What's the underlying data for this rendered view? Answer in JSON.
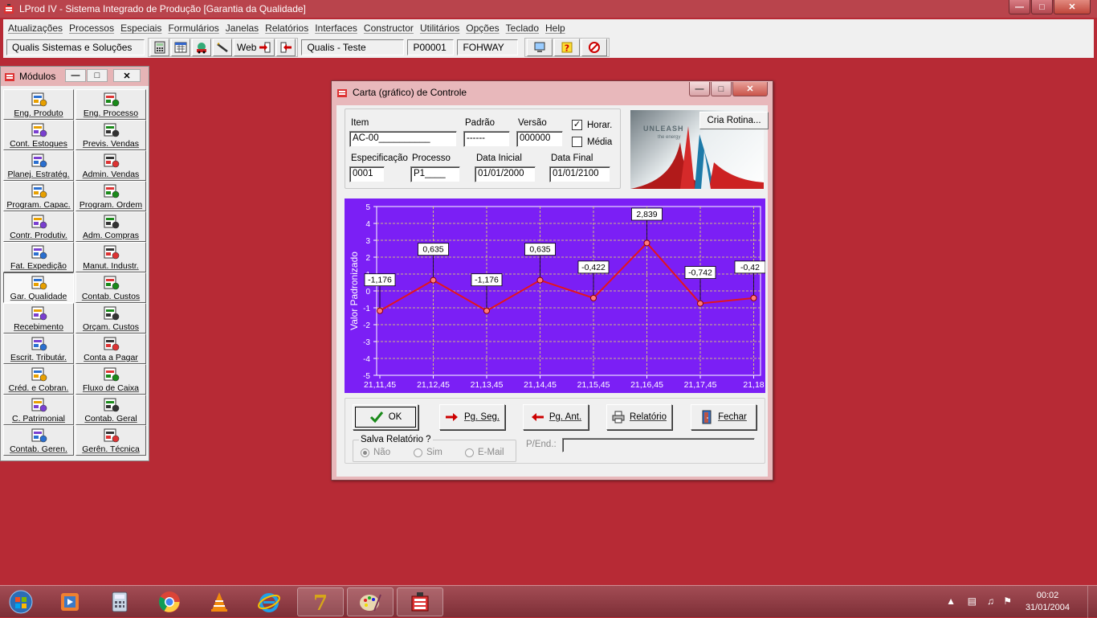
{
  "app": {
    "title": "LProd IV - Sistema Integrado de Produção [Garantia da Qualidade]"
  },
  "menu": [
    "Atualizações",
    "Processos",
    "Especiais",
    "Formulários",
    "Janelas",
    "Relatórios",
    "Interfaces",
    "Constructor",
    "Utilitários",
    "Opções",
    "Teclado",
    "Help"
  ],
  "toolbar": {
    "company": "Qualis Sistemas e Soluções",
    "web_label": "Web",
    "environment": "Qualis - Teste",
    "code": "P00001",
    "user": "FOHWAY"
  },
  "modules": {
    "title": "Módulos",
    "items": [
      {
        "label": "Eng. Produto",
        "icon": "handshake-icon"
      },
      {
        "label": "Eng. Processo",
        "icon": "gear-person-icon"
      },
      {
        "label": "Cont. Estoques",
        "icon": "boxes-icon"
      },
      {
        "label": "Previs. Vendas",
        "icon": "pie-chart-icon"
      },
      {
        "label": "Planej. Estratég.",
        "icon": "bar-chart-icon"
      },
      {
        "label": "Admin. Vendas",
        "icon": "sales-icon"
      },
      {
        "label": "Program. Capac.",
        "icon": "calendar-grid-icon"
      },
      {
        "label": "Program. Ordem",
        "icon": "calendar-icon"
      },
      {
        "label": "Contr. Produtiv.",
        "icon": "line-chart-icon"
      },
      {
        "label": "Adm. Compras",
        "icon": "documents-icon"
      },
      {
        "label": "Fat. Expedição",
        "icon": "arrow-document-icon"
      },
      {
        "label": "Manut. Industr.",
        "icon": "tools-icon"
      },
      {
        "label": "Gar. Qualidade",
        "icon": "quality-chart-icon"
      },
      {
        "label": "Contab. Custos",
        "icon": "calculator-icon"
      },
      {
        "label": "Recebimento",
        "icon": "arrow-in-document-icon"
      },
      {
        "label": "Orçam. Custos",
        "icon": "ledger-icon"
      },
      {
        "label": "Escrit. Tributár.",
        "icon": "books-icon"
      },
      {
        "label": "Conta a Pagar",
        "icon": "payment-icon"
      },
      {
        "label": "Créd. e Cobran.",
        "icon": "money-hand-icon"
      },
      {
        "label": "Fluxo de Caixa",
        "icon": "cash-flow-icon"
      },
      {
        "label": "C. Patrimonial",
        "icon": "building-icon"
      },
      {
        "label": "Contab. Geral",
        "icon": "open-book-icon"
      },
      {
        "label": "Contab. Geren.",
        "icon": "report-icon"
      },
      {
        "label": "Gerên. Técnica",
        "icon": "computer-icon"
      }
    ],
    "active_index": 12
  },
  "dialog": {
    "title": "Carta (gráfico) de Controle",
    "item_label": "Item",
    "item_value": "AC-00__________",
    "padrao_label": "Padrão",
    "padrao_value": "------",
    "versao_label": "Versão",
    "versao_value": "000000",
    "horar_label": "Horar.",
    "horar_checked": true,
    "media_label": "Média",
    "media_checked": false,
    "espec_label": "Especificação",
    "espec_value": "0001",
    "processo_label": "Processo",
    "processo_value": "P1____",
    "data_ini_label": "Data Inicial",
    "data_ini_value": "01/01/2000",
    "data_fim_label": "Data Final",
    "data_fim_value": "01/01/2100",
    "cria_rotina_label": "Cria Rotina...",
    "logo_text": "UNLEASH",
    "logo_sub": "the energy",
    "buttons": {
      "ok": "OK",
      "next": "Pg. Seg.",
      "prev": "Pg. Ant.",
      "report": "Relatório",
      "close": "Fechar"
    },
    "save_report_label": "Salva Relatório ?",
    "radio": {
      "no": "Não",
      "yes": "Sim",
      "email": "E-Mail",
      "selected": "no"
    },
    "pend_label": "P/End.:"
  },
  "chart_data": {
    "type": "line",
    "ylabel": "Valor Padronizado",
    "ylim": [
      -5,
      5
    ],
    "yticks": [
      5,
      4,
      3,
      2,
      1,
      0,
      -1,
      -2,
      -3,
      -4,
      -5
    ],
    "categories": [
      "21,11,45",
      "21,12,45",
      "21,13,45",
      "21,14,45",
      "21,15,45",
      "21,16,45",
      "21,17,45",
      "21,18"
    ],
    "values": [
      -1.176,
      0.635,
      -1.176,
      0.635,
      -0.422,
      2.839,
      -0.742,
      -0.422
    ],
    "data_labels": [
      "-1,176",
      "0,635",
      "-1,176",
      "0,635",
      "-0,422",
      "2,839",
      "-0,742",
      "-0,42"
    ],
    "grid": true,
    "colors": {
      "background": "#7b1ff5",
      "line": "#e4151b",
      "grid": "#e8e860",
      "axis": "#ffffff"
    }
  },
  "taskbar": {
    "apps": [
      "windows-start-icon",
      "media-player-icon",
      "calculator-app-icon",
      "chrome-icon",
      "vlc-icon",
      "ie-icon",
      "app-7-icon",
      "paint-icon",
      "lprod-icon"
    ],
    "time": "00:02",
    "date": "31/01/2004"
  }
}
